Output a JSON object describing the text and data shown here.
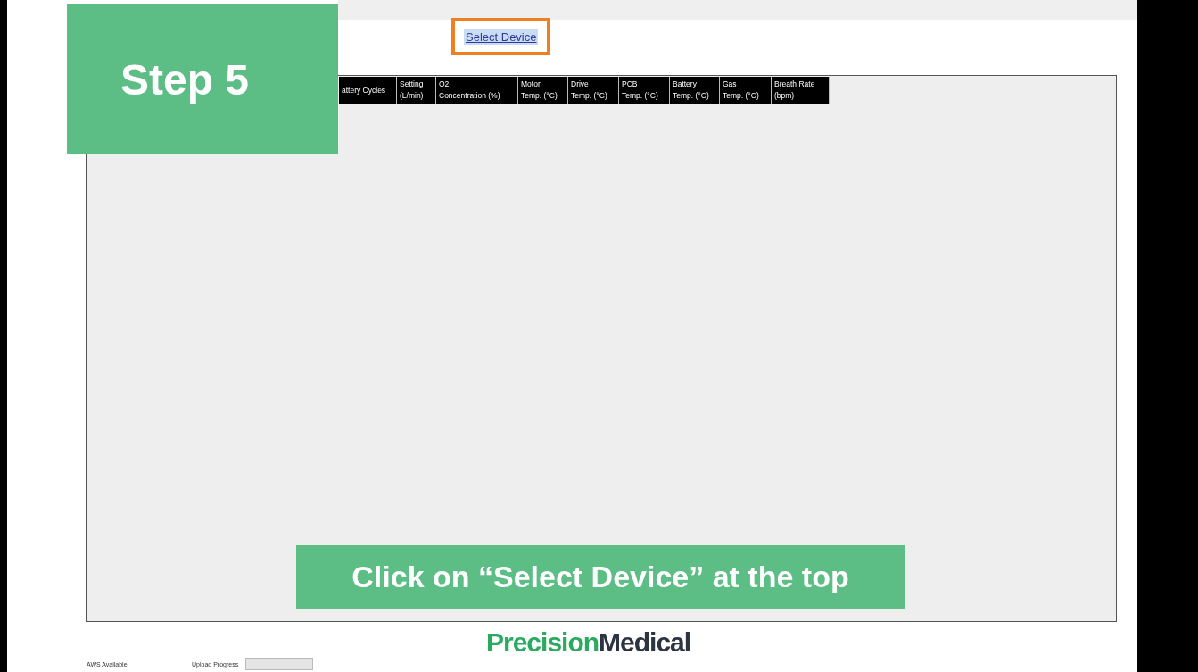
{
  "select_device": {
    "label": "Select Device",
    "selected": true
  },
  "table": {
    "columns": [
      {
        "lines": [
          "attery Cycles"
        ]
      },
      {
        "lines": [
          "Setting",
          "(L/min)"
        ]
      },
      {
        "lines": [
          "O2",
          "Concentration (%)"
        ]
      },
      {
        "lines": [
          "Motor",
          "Temp. (°C)"
        ]
      },
      {
        "lines": [
          "Drive",
          "Temp. (°C)"
        ]
      },
      {
        "lines": [
          "PCB",
          "Temp. (°C)"
        ]
      },
      {
        "lines": [
          "Battery",
          "Temp. (°C)"
        ]
      },
      {
        "lines": [
          "Gas",
          "Temp. (°C)"
        ]
      },
      {
        "lines": [
          "Breath Rate",
          "(bpm)"
        ]
      }
    ]
  },
  "brand": {
    "first": "Precision",
    "second": "Medical"
  },
  "status_bar": {
    "aws": "AWS Available",
    "upload_label": "Upload Progress",
    "upload": {
      "level": 0
    }
  },
  "overlay": {
    "step": "Step 5",
    "caption": "Click on “Select Device” at the top"
  }
}
